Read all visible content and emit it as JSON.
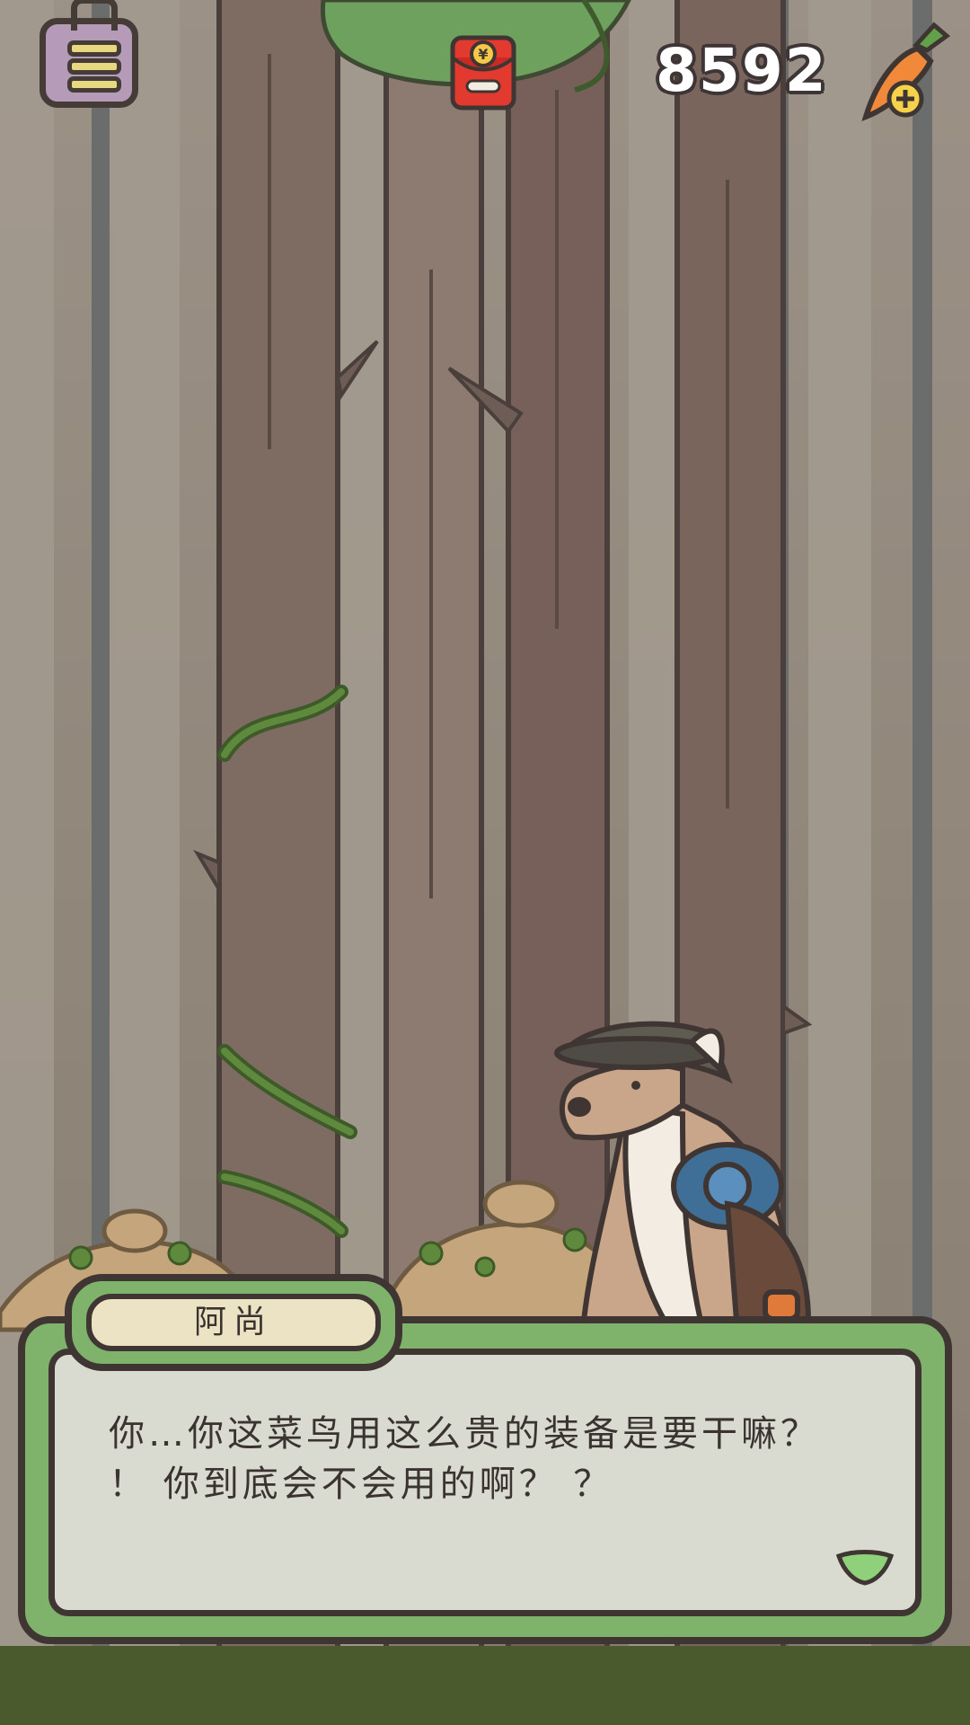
{
  "hud": {
    "menu_icon": "menu-icon",
    "red_packet_icon": "red-envelope-icon",
    "red_packet_symbol": "¥",
    "carrot_count": "8592",
    "add_carrot_icon": "carrot-plus-icon"
  },
  "dialog": {
    "speaker": "阿尚",
    "text": "你…你这菜鸟用这么贵的装备是要干嘛？\n！ 你到底会不会用的啊？ ？",
    "next_icon": "next-arrow-icon"
  },
  "colors": {
    "dialog_frame": "#7fb36c",
    "outline": "#3f3633",
    "name_plate": "#ece2c4",
    "forest_bg": "#8f8577",
    "red_packet": "#e23a2e"
  }
}
